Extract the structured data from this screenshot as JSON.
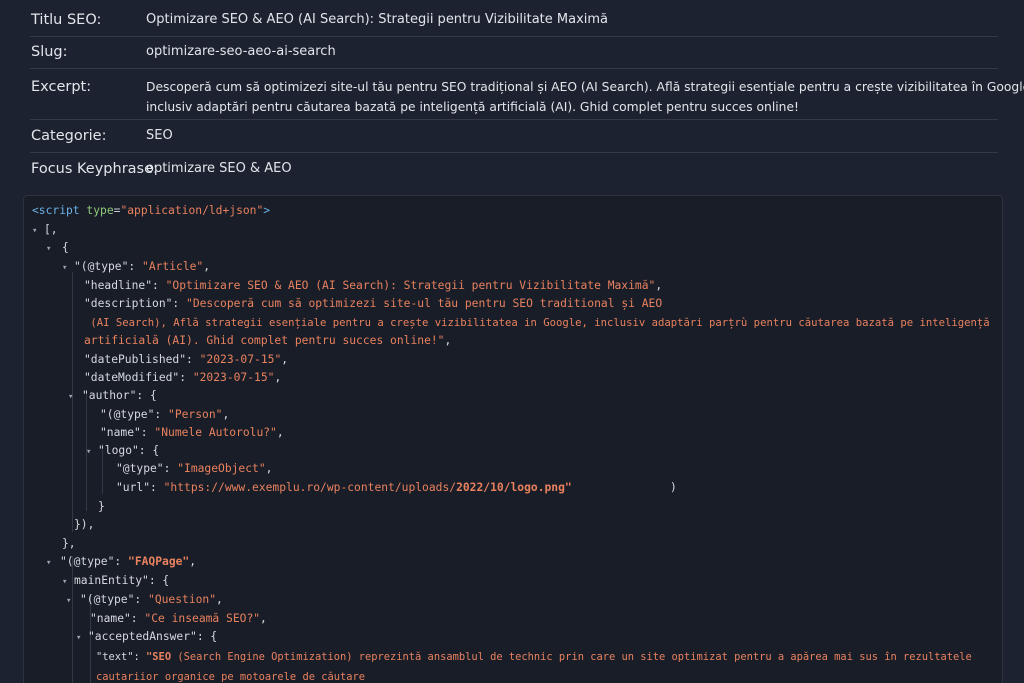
{
  "meta": {
    "title_label": "Titlu SEO:",
    "title_value": "Optimizare SEO & AEO (AI Search): Strategii pentru Vizibilitate Maximă",
    "slug_label": "Slug:",
    "slug_value": "optimizare-seo-aeo-ai-search",
    "excerpt_label": "Excerpt:",
    "excerpt_line1": "Descoperă cum să optimizezi site-ul tău pentru SEO tradițional și AEO (AI Search). Află strategii esențiale pentru a crește vizibilitatea în Google,",
    "excerpt_line2": "inclusiv adaptări pentru căutarea bazată pe inteligență artificială (AI). Ghid complet pentru succes online!",
    "category_label": "Categorie:",
    "category_value": "SEO",
    "keyphrase_label": "Focus Keyphrase:",
    "keyphrase_value": "optimizare SEO & AEO"
  },
  "code": {
    "script_open": "<script",
    "script_attr": "type",
    "script_type": "\"application/ld+json\"",
    "script_close": ">",
    "l_open_arr": "[,",
    "l_open_obj": "{",
    "article_type_key": "\"(@type\": ",
    "article_type_val": "\"Article\"",
    "headline_key": "\"headline\": ",
    "headline_val": "\"Optimizare SEO & AEO (AI Search): Strategii pentru Vizibilitate Maximă\"",
    "description_key": "\"description\": ",
    "description_val1": "\"Descoperă cum să optimizezi site-ul tău pentru SEO traditional și AEO",
    "description_val2": " (AI Search), Află strategii esențiale pentru a crește vizibilitatea in Google, inclusiv adaptări parțrù pentru căutarea bazată pe inteligență",
    "description_val3": "artificială (AI). Ghid complet pentru succes online!\"",
    "date_published_key": "\"datePublished\": ",
    "date_published_val": "\"2023-07-15\"",
    "date_modified_key": "\"dateModified\": ",
    "date_modified_val": "\"2023-07-15\"",
    "author_key": "\"author\": {",
    "person_type_key": "\"(@type\": ",
    "person_type_val": "\"Person\"",
    "name_key": "\"name\": ",
    "name_val": "\"Numele Autorolu?\"",
    "logo_key": "\"logo\": {",
    "image_type_key": "\"@type\": ",
    "image_type_val": "\"ImageObject\"",
    "url_key": "\"url\": ",
    "url_val_a": "\"https://www.exemplu.ro/wp-content/uploads/",
    "url_val_b": "2022/10/logo.png\"",
    "url_tail": ")",
    "close_brace": "}",
    "close_author": "}),",
    "close_article": "},",
    "faq_type_key": "\"(@type\": ",
    "faq_type_val": "\"FAQPage\"",
    "main_entity_key": "mainEntity\": {",
    "question_type_key": "\"(@type\": ",
    "question_type_val": "\"Question\"",
    "q_name_key": "\"name\": ",
    "q_name_val": "\"Ce inseamă SEO?\"",
    "accepted_key": "\"acceptedAnswer\": {",
    "text_key": "\"text\": ",
    "text_val_bold": "\"SEO",
    "text_val1": " (Search Engine Optimization) reprezintă ansamblul de technic prin care un site optimizat pentru a apărea mai sus în rezultatele",
    "text_val2": "cautariior organice pe motoarele de căutare",
    "close_answer": "},"
  }
}
